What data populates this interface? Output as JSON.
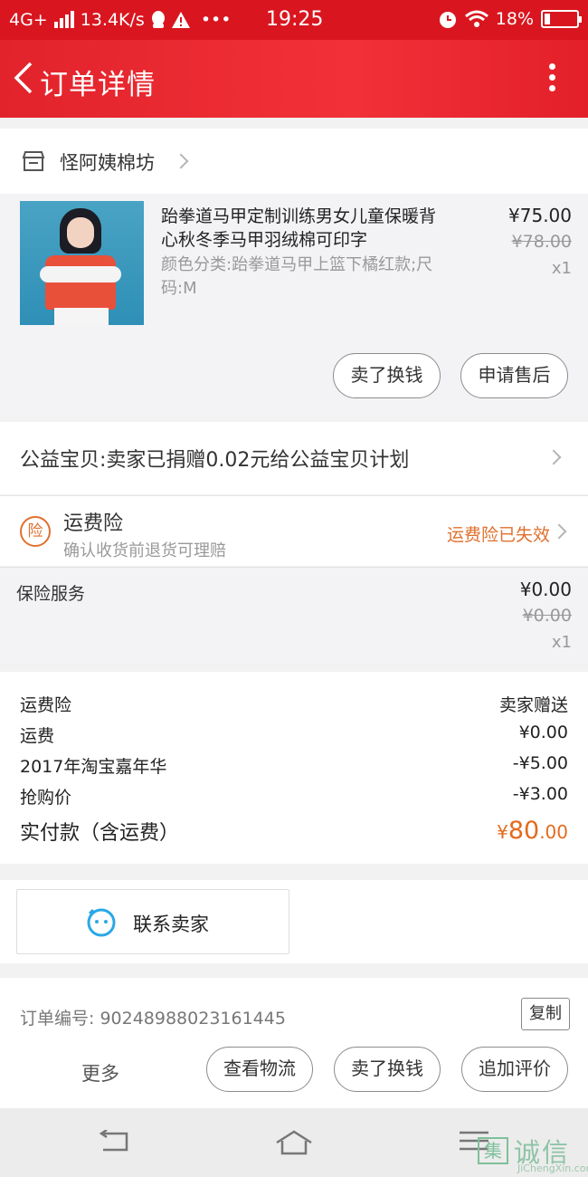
{
  "status_bar": {
    "network": "4G+",
    "speed": "13.4K/s",
    "time": "19:25",
    "battery": "18%"
  },
  "header": {
    "title": "订单详情"
  },
  "shop": {
    "name": "怪阿姨棉坊"
  },
  "product": {
    "title": "跆拳道马甲定制训练男女儿童保暖背心秋冬季马甲羽绒棉可印字",
    "spec": "颜色分类:跆拳道马甲上篮下橘红款;尺码:M",
    "price": "¥75.00",
    "original_price": "¥78.00",
    "quantity": "x1",
    "buttons": {
      "resell": "卖了换钱",
      "after_sale": "申请售后"
    }
  },
  "charity": {
    "text": "公益宝贝:卖家已捐赠0.02元给公益宝贝计划"
  },
  "shipping_insurance": {
    "badge": "险",
    "title": "运费险",
    "subtitle": "确认收货前退货可理赔",
    "status": "运费险已失效"
  },
  "insurance_service": {
    "label": "保险服务",
    "price": "¥0.00",
    "original_price": "¥0.00",
    "quantity": "x1"
  },
  "fees": [
    {
      "label": "运费险",
      "value": "卖家赠送"
    },
    {
      "label": "运费",
      "value": "¥0.00"
    },
    {
      "label": "2017年淘宝嘉年华",
      "value": "-¥5.00"
    },
    {
      "label": "抢购价",
      "value": "-¥3.00"
    }
  ],
  "total": {
    "label": "实付款（含运费）",
    "currency": "¥",
    "amount": "80",
    "cents": ".00"
  },
  "contact": {
    "label": "联系卖家"
  },
  "order": {
    "number_text": "订单编号: 90248988023161445",
    "copy_label": "复制"
  },
  "actions": {
    "more": "更多",
    "logistics": "查看物流",
    "resell": "卖了换钱",
    "add_review": "追加评价"
  },
  "watermark": {
    "text": "诚信",
    "url": "JiChengXin.com",
    "box": "集"
  },
  "colors": {
    "brand_red": "#e2232b",
    "accent_orange": "#e46a1d"
  }
}
